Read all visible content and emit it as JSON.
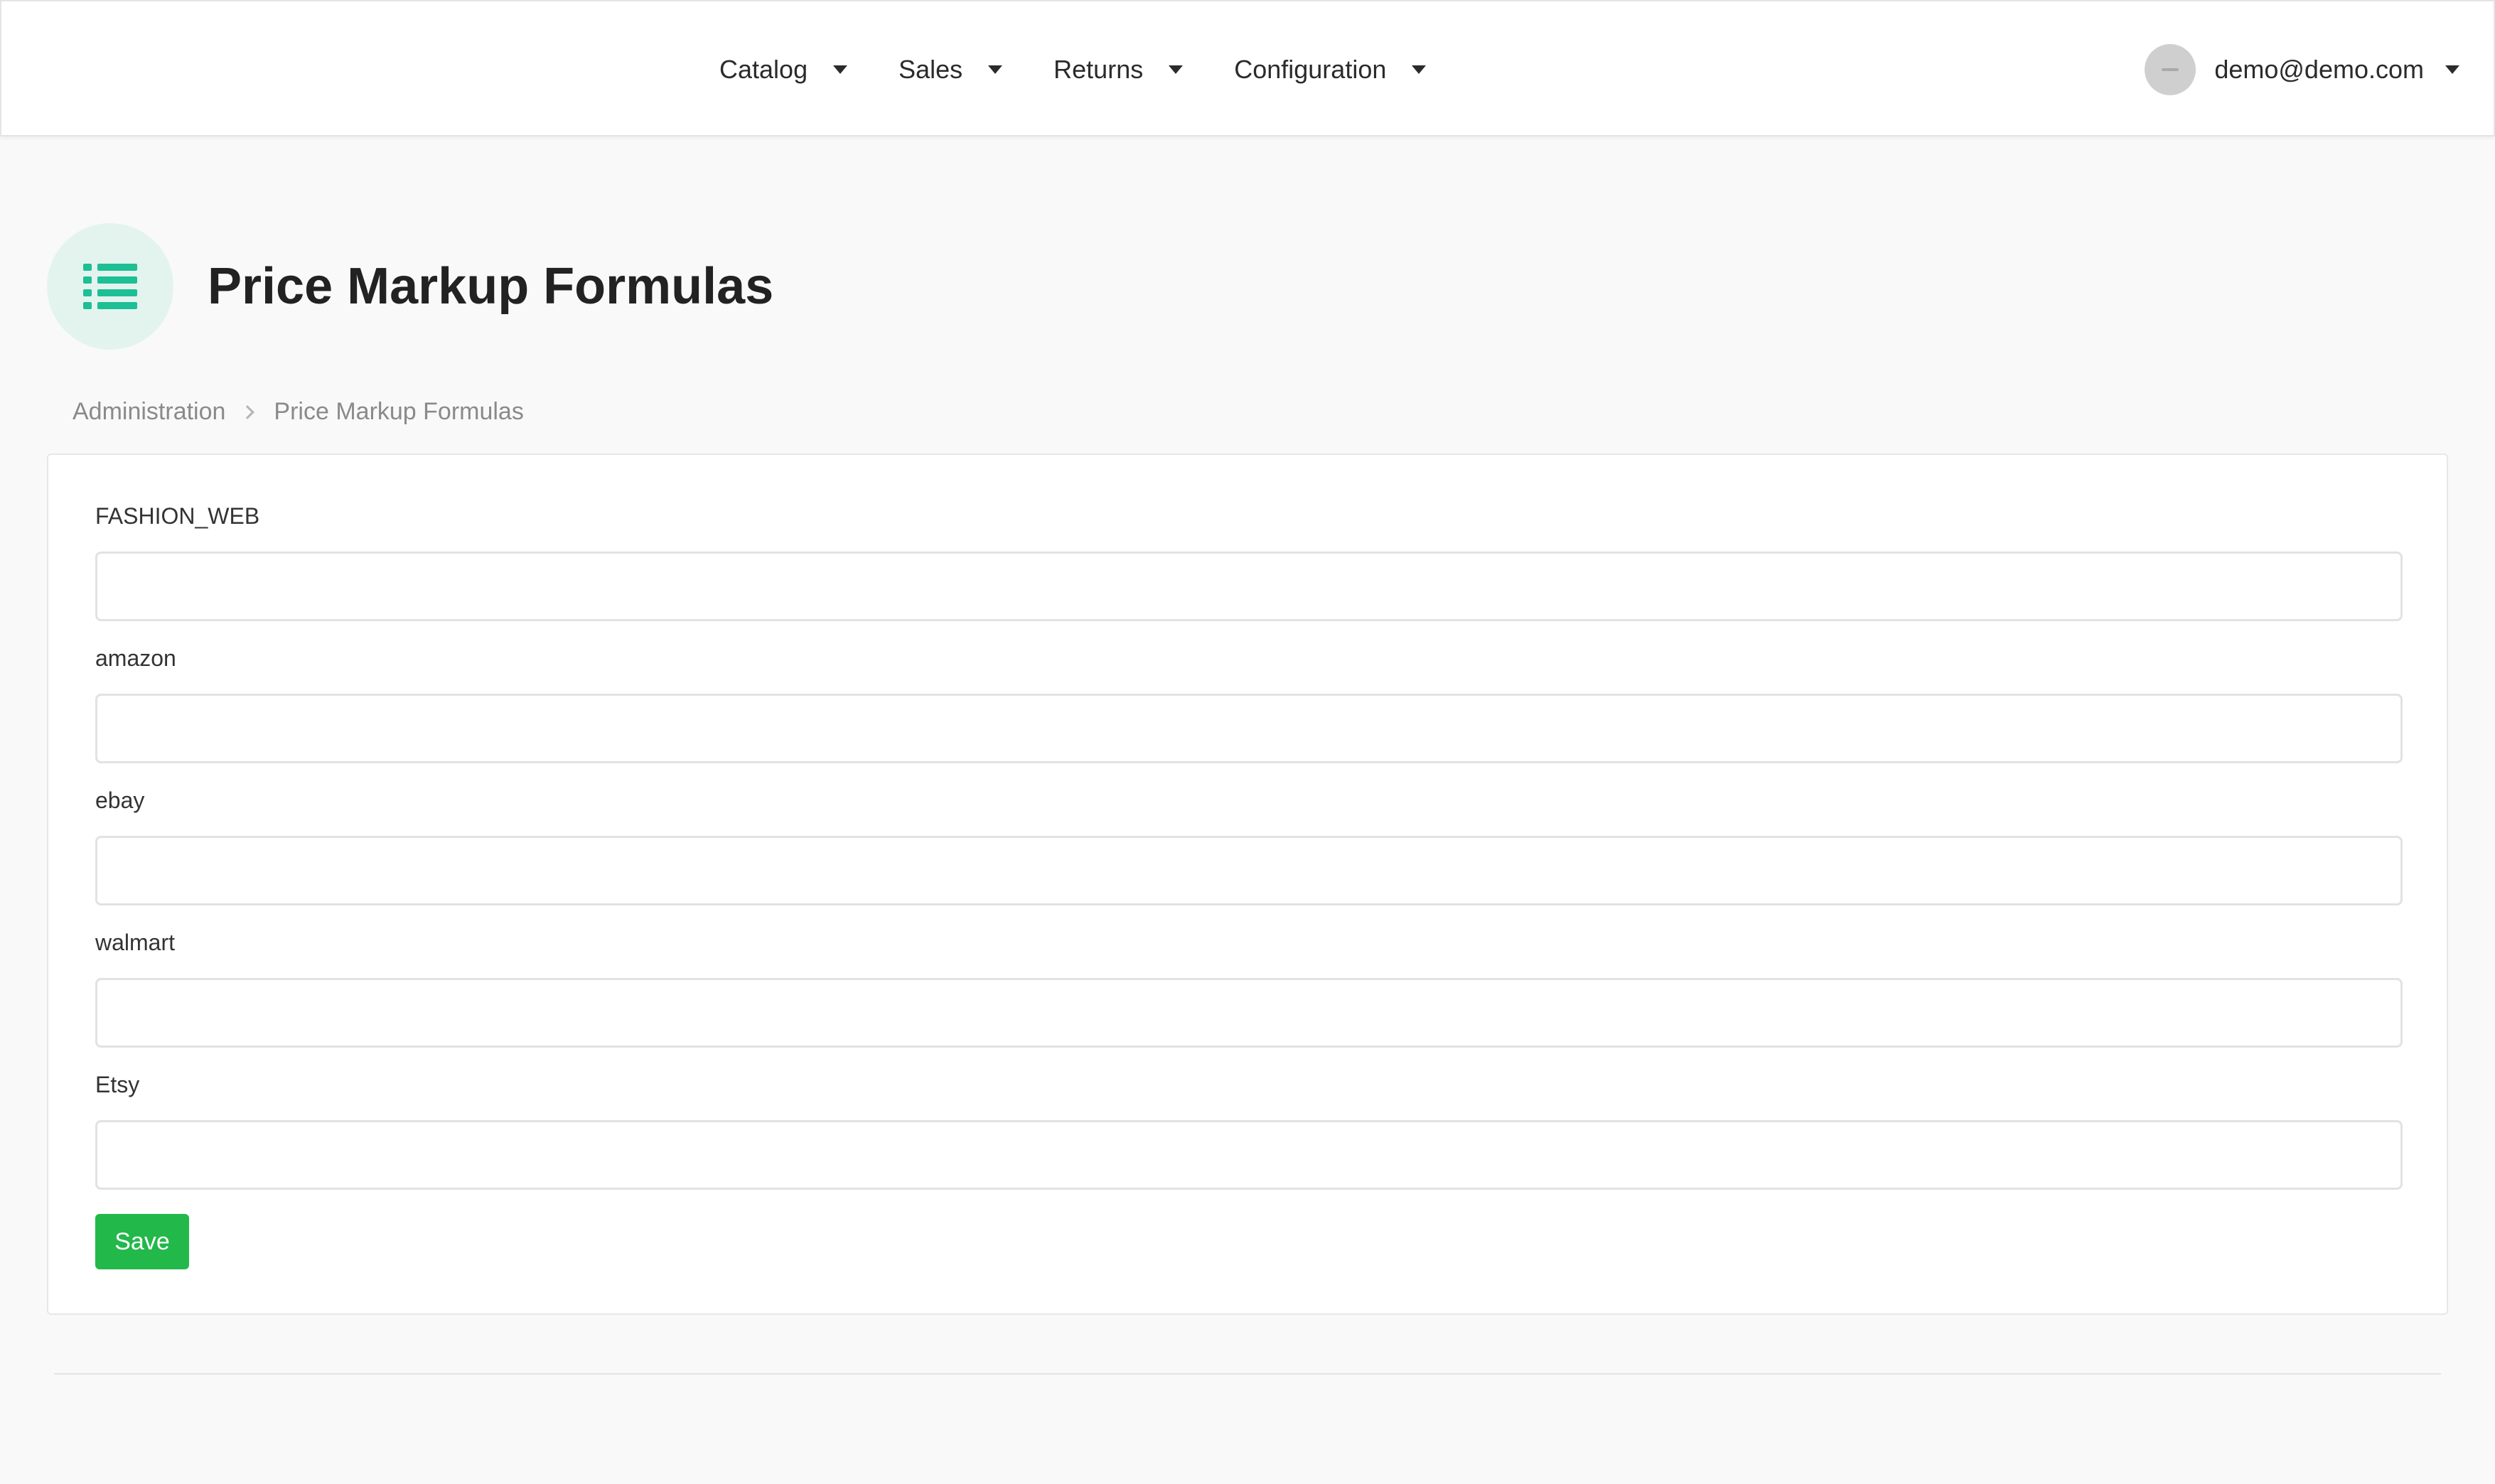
{
  "header": {
    "nav": [
      {
        "label": "Catalog"
      },
      {
        "label": "Sales"
      },
      {
        "label": "Returns"
      },
      {
        "label": "Configuration"
      }
    ],
    "user": {
      "email": "demo@demo.com"
    }
  },
  "page": {
    "title": "Price Markup Formulas",
    "icon": "list-icon",
    "accent_color": "#1dbf95"
  },
  "breadcrumb": {
    "items": [
      "Administration",
      "Price Markup Formulas"
    ]
  },
  "form": {
    "fields": [
      {
        "label": "FASHION_WEB",
        "value": ""
      },
      {
        "label": "amazon",
        "value": ""
      },
      {
        "label": "ebay",
        "value": ""
      },
      {
        "label": "walmart",
        "value": ""
      },
      {
        "label": "Etsy",
        "value": ""
      }
    ],
    "save_label": "Save",
    "save_color": "#22b84a"
  }
}
